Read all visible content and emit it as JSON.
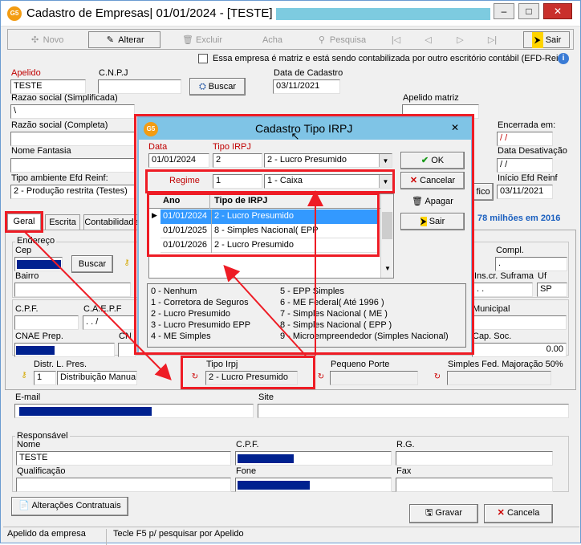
{
  "window": {
    "title": "Cadastro de Empresas|  01/01/2024 - [TESTE] -",
    "app_icon": "G5",
    "minimize": "–",
    "maximize": "□",
    "close": "✕"
  },
  "toolbar": {
    "novo": "Novo",
    "alterar": "Alterar",
    "excluir": "Excluir",
    "acha": "Acha",
    "pesquisa": "Pesquisa",
    "sair": "Sair"
  },
  "header": {
    "matriz_check_label": "Essa empresa é matriz e está sendo contabilizada por outro escritório contábil (EFD-Reinf"
  },
  "fields": {
    "apelido_label": "Apelido",
    "apelido_value": "TESTE",
    "cnpj_label": "C.N.P.J",
    "buscar_label": "Buscar",
    "data_cadastro_label": "Data de Cadastro",
    "data_cadastro_value": "03/11/2021",
    "razao_simplificada_label": "Razao social (Simplificada)",
    "razao_simplificada_value": "\\",
    "apelido_matriz_label": "Apelido matriz",
    "razao_completa_label": "Razão social (Completa)",
    "encerrada_label": "Encerrada em:",
    "encerrada_value": "/ /",
    "nome_fantasia_label": "Nome Fantasia",
    "data_desativacao_label": "Data Desativação",
    "data_desativacao_value": "/ /",
    "tipo_ambiente_label": "Tipo ambiente Efd Reinf:",
    "tipo_ambiente_value": "2 - Produção restrita (Testes)",
    "inicio_efd_label": "Início Efd Reinf",
    "inicio_efd_value": "03/11/2021",
    "btn_fico": "fico",
    "info_text": "78 milhões em 2016"
  },
  "tabs": {
    "geral": "Geral",
    "escrita": "Escrita",
    "contabilidade": "Contabilidade"
  },
  "geral": {
    "endereco_label": "Endereço",
    "cep_label": "Cep",
    "buscar_label": "Buscar",
    "compl_label": "Compl.",
    "compl_value": ".",
    "bairro_label": "Bairro",
    "suframa_label": "Ins.cr. Suframa",
    "suframa_value": ". .",
    "uf_label": "Uf",
    "uf_value": "SP",
    "cpf_label": "C.P.F.",
    "caepf_label": "C.A.E.P.F",
    "caepf_value": ". . /",
    "municipal_label": "Municipal",
    "cnae_label": "CNAE Prep.",
    "cn_label": "CN",
    "cap_soc_label": "Cap. Soc.",
    "cap_soc_value": "0.00",
    "distr_label": "Distr. L. Pres.",
    "distr_code": "1",
    "distr_value": "Distribuição Manual",
    "tipo_irpj_label": "Tipo Irpj",
    "tipo_irpj_value": "2 - Lucro Presumido",
    "pequeno_porte_label": "Pequeno Porte",
    "simples_label": "Simples Fed. Majoração 50%",
    "email_label": "E-mail",
    "site_label": "Site"
  },
  "responsavel": {
    "group_label": "Responsável",
    "nome_label": "Nome",
    "nome_value": "TESTE",
    "cpf_label": "C.P.F.",
    "rg_label": "R.G.",
    "qualificacao_label": "Qualificação",
    "fone_label": "Fone",
    "fax_label": "Fax"
  },
  "bottom": {
    "alteracoes_label": "Alterações Contratuais",
    "gravar_label": "Gravar",
    "cancela_label": "Cancela"
  },
  "status": {
    "left": "Apelido da empresa",
    "right": "Tecle F5 p/ pesquisar por Apelido"
  },
  "dialog": {
    "title": "Cadastro Tipo IRPJ",
    "close": "✕",
    "data_label": "Data",
    "data_value": "01/01/2024",
    "tipo_irpj_label": "Tipo IRPJ",
    "tipo_irpj_code": "2",
    "tipo_irpj_desc": "2 - Lucro Presumido",
    "regime_label": "Regime",
    "regime_code": "1",
    "regime_desc": "1 - Caixa",
    "ok_label": "OK",
    "cancelar_label": "Cancelar",
    "apagar_label": "Apagar",
    "sair_label": "Sair",
    "grid_headers": [
      "Ano",
      "Tipo de IRPJ"
    ],
    "grid_rows": [
      {
        "ano": "01/01/2024",
        "tipo": "2 - Lucro Presumido"
      },
      {
        "ano": "01/01/2025",
        "tipo": "8 - Simples Nacional( EPP"
      },
      {
        "ano": "01/01/2026",
        "tipo": "2 - Lucro Presumido"
      }
    ],
    "legend_left": [
      "0 - Nenhum",
      "1 - Corretora de Seguros",
      "2 - Lucro Presumido",
      "3 - Lucro Presumido EPP",
      "4 - ME Simples"
    ],
    "legend_right": [
      "5 - EPP Simples",
      "6 - ME Federal( Até 1996 )",
      "7 - Simples Nacional ( ME )",
      "8 - Simples Nacional ( EPP )",
      "9 - Microempreendedor (Simples Nacional)"
    ]
  },
  "colors": {
    "annotation_red": "#ee1c25",
    "mask_blue": "#00218f",
    "dialog_title": "#7fc4e6",
    "selected_row": "#3399ff"
  }
}
